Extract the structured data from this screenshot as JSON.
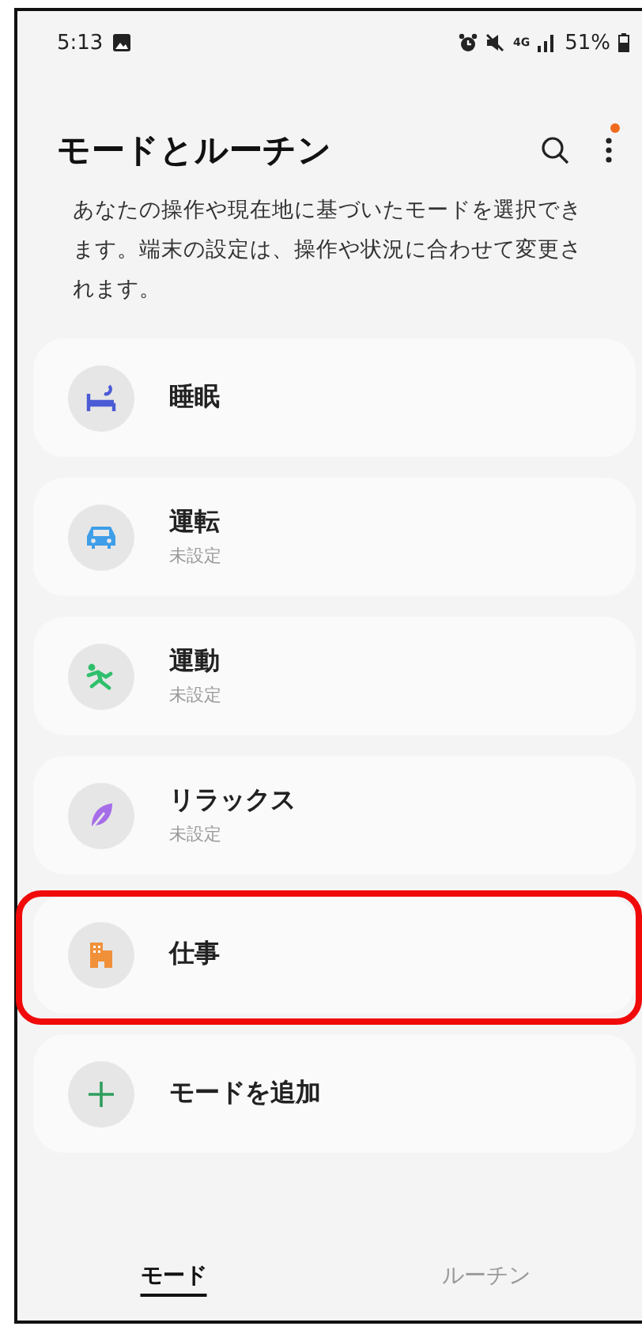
{
  "status_bar": {
    "time": "5:13",
    "network": "4G",
    "battery": "51%"
  },
  "header": {
    "title": "モードとルーチン",
    "menu_badge": true,
    "description": "あなたの操作や現在地に基づいたモードを選択できます。端末の設定は、操作や状況に合わせて変更されます。"
  },
  "modes": [
    {
      "kind": "sleep",
      "name": "睡眠",
      "highlighted": false
    },
    {
      "kind": "driving",
      "name": "運転",
      "subtitle": "未設定",
      "highlighted": false
    },
    {
      "kind": "exercise",
      "name": "運動",
      "subtitle": "未設定",
      "highlighted": false
    },
    {
      "kind": "relax",
      "name": "リラックス",
      "subtitle": "未設定",
      "highlighted": false
    },
    {
      "kind": "work",
      "name": "仕事",
      "highlighted": true
    },
    {
      "kind": "add",
      "name": "モードを追加",
      "highlighted": false
    }
  ],
  "tabs": [
    {
      "label": "モード",
      "selected": true
    },
    {
      "label": "ルーチン",
      "selected": false
    }
  ]
}
